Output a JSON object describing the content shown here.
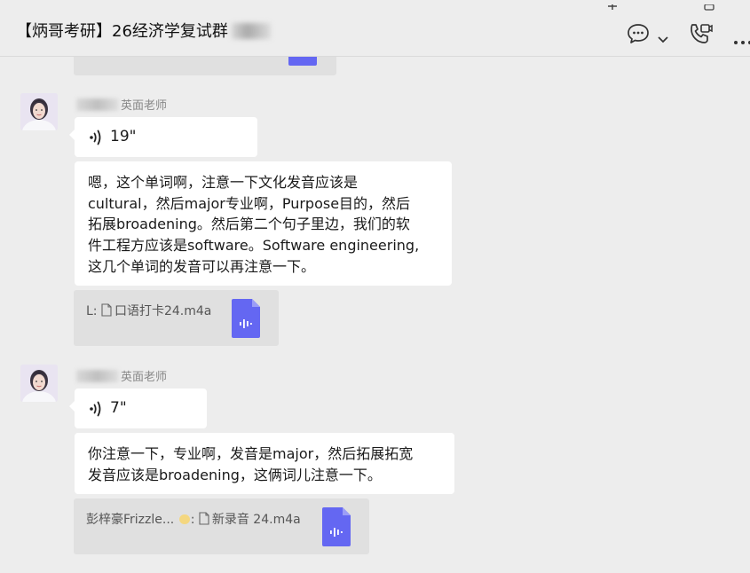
{
  "header": {
    "title": "【炳哥考研】26经济学复试群",
    "icons": [
      "chat-bubble-icon",
      "chevron-down-icon",
      "video-call-icon",
      "more-icon"
    ]
  },
  "messages": [
    {
      "sender_suffix": "英面老师",
      "voice_duration": "19\"",
      "text_lines": [
        "嗯，这个单词啊，注意一下文化发音应该是",
        "cultural，然后major专业啊，Purpose目的，然后",
        "拓展broadening。然后第二个句子里边，我们的软",
        "件工程方应该是software。Software engineering,",
        "这几个单词的发音可以再注意一下。"
      ],
      "quote": {
        "prefix": "L:",
        "file_name": "口语打卡24.m4a"
      }
    },
    {
      "sender_suffix": "英面老师",
      "voice_duration": "7\"",
      "text_lines": [
        "你注意一下，专业啊，发音是major，然后拓展拓宽",
        "发音应该是broadening，这俩词儿注意一下。"
      ],
      "quote": {
        "prefix": "彭梓豪Frizzle... ",
        "prefix_suffix": ":",
        "file_name": "新录音 24.m4a"
      }
    }
  ],
  "colors": {
    "background": "#ededed",
    "bubble": "#ffffff",
    "quote": "#e0e0e0",
    "file_icon": "#6467f2"
  }
}
